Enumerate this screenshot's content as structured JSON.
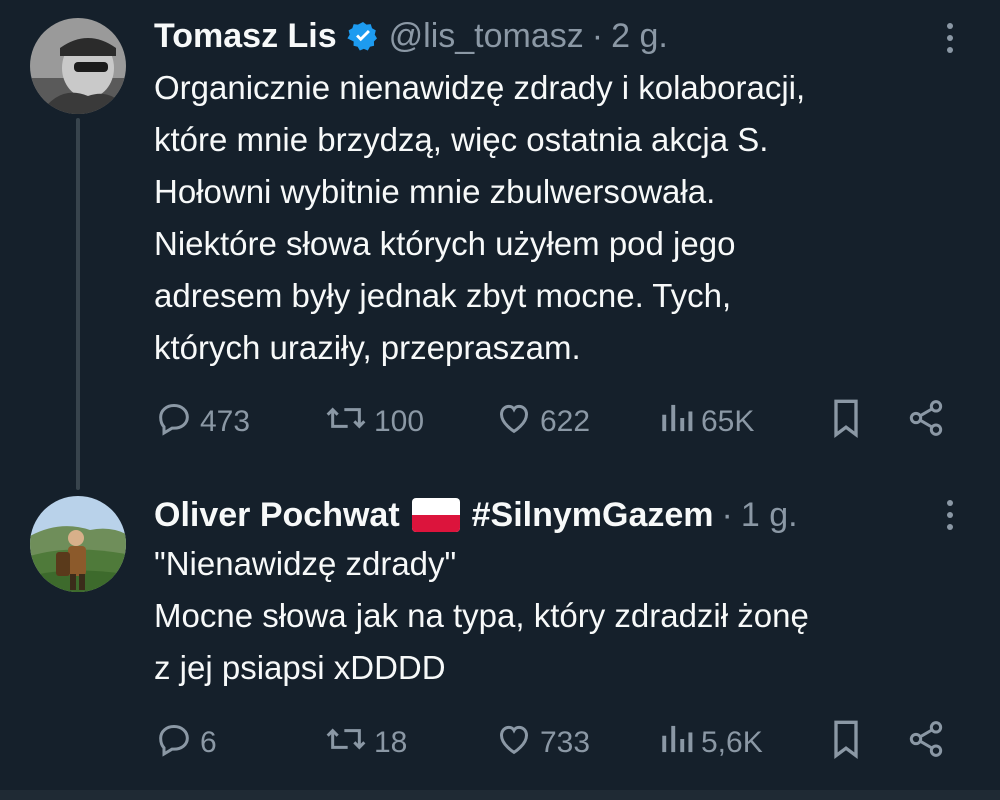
{
  "tweets": [
    {
      "name": "Tomasz Lis",
      "handle": "@lis_tomasz",
      "separator": "·",
      "time": "2 g.",
      "verified": true,
      "lines": [
        "Organicznie nienawidzę zdrady i kolaboracji,",
        "które mnie brzydzą, więc ostatnia akcja S.",
        "Hołowni wybitnie mnie zbulwersowała.",
        "Niektóre słowa których użyłem pod jego",
        "adresem były jednak zbyt mocne. Tych,",
        "których uraziły, przepraszam."
      ],
      "stats": {
        "replies": "473",
        "retweets": "100",
        "likes": "622",
        "views": "65K"
      }
    },
    {
      "name": "Oliver Pochwat",
      "flag": "poland-flag",
      "hashtag": "#SilnymGazem",
      "separator": "·",
      "time": "1 g.",
      "lines": [
        "\"Nienawidzę zdrady\"",
        "Mocne słowa jak na typa, który zdradził żonę",
        "z jej psiapsi xDDDD"
      ],
      "stats": {
        "replies": "6",
        "retweets": "18",
        "likes": "733",
        "views": "5,6K"
      }
    }
  ],
  "colors": {
    "background": "#15202b",
    "text": "#f7f9f9",
    "muted": "#8b98a5",
    "verified": "#1d9bf0",
    "thread_line": "#38444d"
  },
  "icons": [
    "reply-icon",
    "retweet-icon",
    "like-icon",
    "views-icon",
    "bookmark-icon",
    "share-icon",
    "more-icon",
    "verified-badge-icon"
  ]
}
